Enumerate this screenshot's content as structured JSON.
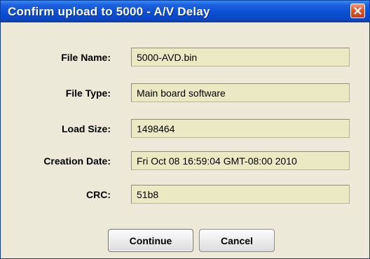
{
  "dialog": {
    "title": "Confirm upload to 5000 - A/V Delay",
    "close_icon": "close-icon"
  },
  "fields": [
    {
      "label": "File Name:",
      "value": "5000-AVD.bin"
    },
    {
      "label": "File Type:",
      "value": "Main board software"
    },
    {
      "label": "Load Size:",
      "value": "1498464"
    },
    {
      "label": "Creation Date:",
      "value": "Fri Oct 08 16:59:04 GMT-08:00 2010"
    },
    {
      "label": "CRC:",
      "value": "51b8"
    }
  ],
  "buttons": {
    "continue_label": "Continue",
    "cancel_label": "Cancel"
  },
  "colors": {
    "titlebar": "#0b4fd6",
    "dialog_bg": "#ece9d8",
    "field_bg": "#ebe8c4",
    "close_button": "#e3552f"
  }
}
